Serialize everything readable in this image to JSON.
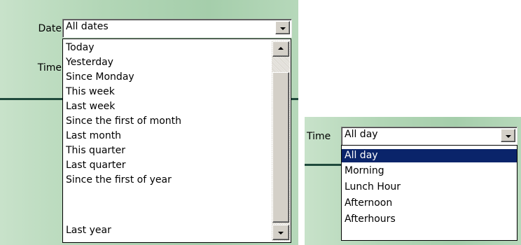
{
  "date_picker": {
    "label": "Date",
    "value": "All dates",
    "options": [
      "Today",
      "Yesterday",
      "Since Monday",
      "This week",
      "Last week",
      "Since the first of month",
      "Last month",
      "This quarter",
      "Last quarter",
      "Since the first of year",
      "Last year"
    ],
    "time_label_behind": "Time"
  },
  "time_picker": {
    "label": "Time",
    "value": "All day",
    "selected_option": "All day",
    "options": [
      "All day",
      "Morning",
      "Lunch Hour",
      "Afternoon",
      "Afterhours"
    ]
  },
  "colors": {
    "panel_green": "#a5ceab",
    "rule_dark_green": "#1f4a3c",
    "selection_blue": "#0a246a",
    "button_face": "#d4d0c8"
  },
  "icons": {
    "dropdown_arrow": "chevron-down-icon",
    "scroll_up": "scroll-up-arrow-icon",
    "scroll_down": "scroll-down-arrow-icon"
  }
}
